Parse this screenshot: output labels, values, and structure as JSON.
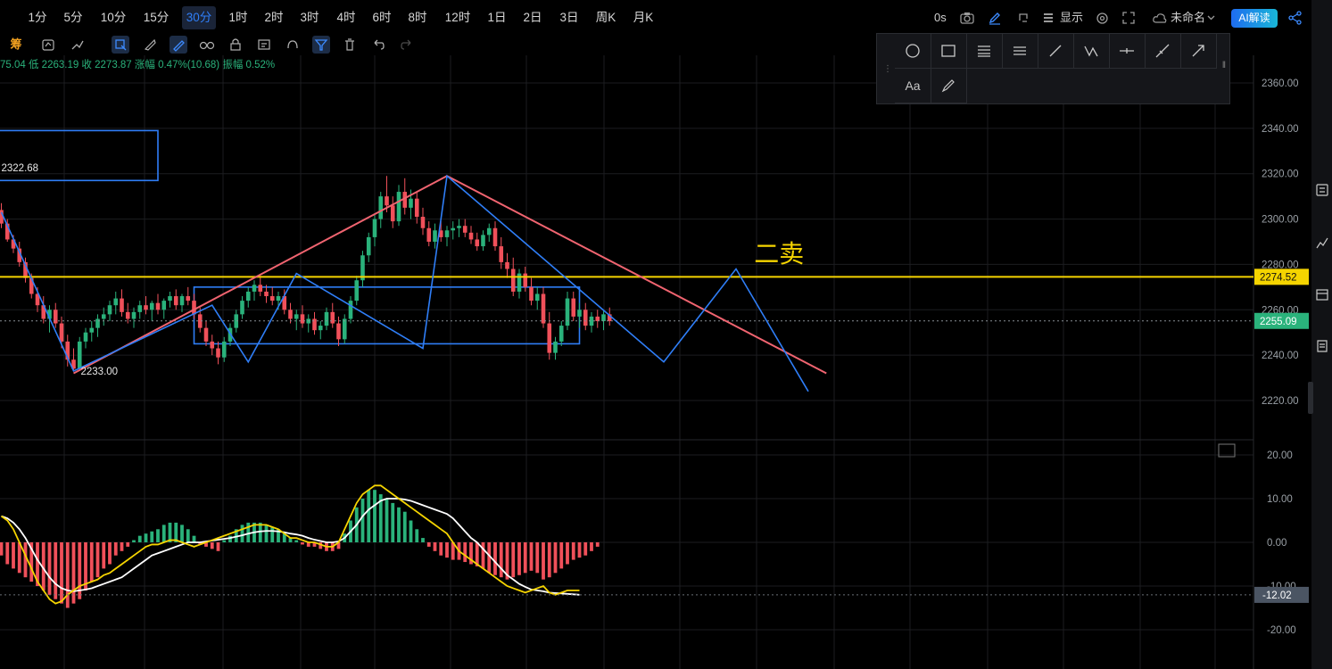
{
  "intervals": [
    "1分",
    "5分",
    "10分",
    "15分",
    "30分",
    "1时",
    "2时",
    "3时",
    "4时",
    "6时",
    "8时",
    "12时",
    "1日",
    "2日",
    "3日",
    "周K",
    "月K"
  ],
  "active_interval": "30分",
  "topbar_right": {
    "countdown": "0s",
    "display_label": "显示",
    "layout_name": "未命名",
    "ai_button": "AI解读"
  },
  "toolbar2": {
    "chip_label": "筹"
  },
  "ohlc_line": "75.04  低 2263.19  收 2273.87  涨幅 0.47%(10.68)  振幅 0.52%",
  "drawing_panel": {
    "text_tool": "Aa"
  },
  "colors": {
    "up": "#2ab27b",
    "down": "#f0505a",
    "trend": "#f06470",
    "blue": "#2f7ef7",
    "yellow": "#f5d400",
    "price_tag": "#2ab27b",
    "grid": "#1c1d20"
  },
  "chart_data": {
    "type": "candlestick",
    "main": {
      "ylim": [
        2210,
        2370
      ],
      "y_ticks": [
        "2360.00",
        "2340.00",
        "2320.00",
        "2300.00",
        "2280.00",
        "2260.00",
        "2240.00",
        "2220.00"
      ],
      "candles": [
        [
          2304,
          2307,
          2296,
          2298
        ],
        [
          2298,
          2300,
          2290,
          2291
        ],
        [
          2291,
          2293,
          2285,
          2287
        ],
        [
          2287,
          2290,
          2279,
          2281
        ],
        [
          2281,
          2283,
          2272,
          2274
        ],
        [
          2274,
          2276,
          2265,
          2267
        ],
        [
          2267,
          2270,
          2259,
          2262
        ],
        [
          2262,
          2266,
          2254,
          2256
        ],
        [
          2256,
          2262,
          2250,
          2260
        ],
        [
          2260,
          2263,
          2252,
          2254
        ],
        [
          2254,
          2257,
          2243,
          2246
        ],
        [
          2246,
          2249,
          2235,
          2238
        ],
        [
          2238,
          2243,
          2233,
          2234
        ],
        [
          2234,
          2248,
          2233,
          2246
        ],
        [
          2246,
          2252,
          2243,
          2250
        ],
        [
          2250,
          2255,
          2246,
          2252
        ],
        [
          2252,
          2258,
          2248,
          2256
        ],
        [
          2256,
          2261,
          2253,
          2258
        ],
        [
          2258,
          2264,
          2255,
          2262
        ],
        [
          2262,
          2268,
          2258,
          2265
        ],
        [
          2265,
          2269,
          2257,
          2259
        ],
        [
          2259,
          2263,
          2254,
          2256
        ],
        [
          2256,
          2261,
          2252,
          2259
        ],
        [
          2259,
          2264,
          2256,
          2262
        ],
        [
          2262,
          2266,
          2258,
          2260
        ],
        [
          2260,
          2264,
          2255,
          2263
        ],
        [
          2263,
          2267,
          2258,
          2260
        ],
        [
          2260,
          2265,
          2256,
          2264
        ],
        [
          2264,
          2268,
          2261,
          2266
        ],
        [
          2266,
          2269,
          2260,
          2262
        ],
        [
          2262,
          2267,
          2259,
          2266
        ],
        [
          2266,
          2270,
          2262,
          2264
        ],
        [
          2264,
          2267,
          2256,
          2258
        ],
        [
          2258,
          2261,
          2250,
          2252
        ],
        [
          2252,
          2255,
          2244,
          2246
        ],
        [
          2246,
          2249,
          2240,
          2243
        ],
        [
          2243,
          2246,
          2236,
          2239
        ],
        [
          2239,
          2248,
          2237,
          2246
        ],
        [
          2246,
          2254,
          2244,
          2252
        ],
        [
          2252,
          2260,
          2250,
          2258
        ],
        [
          2258,
          2266,
          2256,
          2264
        ],
        [
          2264,
          2270,
          2261,
          2268
        ],
        [
          2268,
          2273,
          2264,
          2271
        ],
        [
          2271,
          2275,
          2266,
          2268
        ],
        [
          2268,
          2271,
          2263,
          2266
        ],
        [
          2266,
          2270,
          2262,
          2264
        ],
        [
          2264,
          2268,
          2260,
          2266
        ],
        [
          2266,
          2269,
          2258,
          2260
        ],
        [
          2260,
          2263,
          2254,
          2256
        ],
        [
          2256,
          2260,
          2251,
          2258
        ],
        [
          2258,
          2262,
          2252,
          2254
        ],
        [
          2254,
          2258,
          2250,
          2256
        ],
        [
          2256,
          2259,
          2249,
          2251
        ],
        [
          2251,
          2255,
          2247,
          2253
        ],
        [
          2253,
          2261,
          2251,
          2259
        ],
        [
          2259,
          2263,
          2252,
          2254
        ],
        [
          2254,
          2257,
          2244,
          2247
        ],
        [
          2247,
          2258,
          2245,
          2256
        ],
        [
          2256,
          2266,
          2254,
          2264
        ],
        [
          2264,
          2275,
          2262,
          2273
        ],
        [
          2273,
          2286,
          2270,
          2284
        ],
        [
          2284,
          2294,
          2281,
          2292
        ],
        [
          2292,
          2302,
          2288,
          2300
        ],
        [
          2300,
          2312,
          2296,
          2310
        ],
        [
          2310,
          2319,
          2303,
          2306
        ],
        [
          2306,
          2310,
          2296,
          2299
        ],
        [
          2299,
          2315,
          2297,
          2312
        ],
        [
          2312,
          2318,
          2302,
          2305
        ],
        [
          2305,
          2313,
          2300,
          2309
        ],
        [
          2309,
          2312,
          2298,
          2301
        ],
        [
          2301,
          2305,
          2293,
          2296
        ],
        [
          2296,
          2299,
          2288,
          2290
        ],
        [
          2290,
          2298,
          2287,
          2295
        ],
        [
          2295,
          2299,
          2290,
          2292
        ],
        [
          2292,
          2297,
          2288,
          2295
        ],
        [
          2295,
          2299,
          2291,
          2296
        ],
        [
          2296,
          2300,
          2292,
          2297
        ],
        [
          2297,
          2300,
          2292,
          2294
        ],
        [
          2294,
          2297,
          2289,
          2291
        ],
        [
          2291,
          2294,
          2286,
          2288
        ],
        [
          2288,
          2295,
          2286,
          2293
        ],
        [
          2293,
          2298,
          2290,
          2296
        ],
        [
          2296,
          2299,
          2286,
          2288
        ],
        [
          2288,
          2292,
          2278,
          2281
        ],
        [
          2281,
          2285,
          2274,
          2278
        ],
        [
          2278,
          2283,
          2266,
          2268
        ],
        [
          2268,
          2278,
          2265,
          2276
        ],
        [
          2276,
          2279,
          2268,
          2270
        ],
        [
          2270,
          2274,
          2262,
          2264
        ],
        [
          2264,
          2270,
          2260,
          2267
        ],
        [
          2267,
          2270,
          2252,
          2254
        ],
        [
          2254,
          2259,
          2238,
          2241
        ],
        [
          2241,
          2248,
          2238,
          2246
        ],
        [
          2246,
          2255,
          2244,
          2253
        ],
        [
          2253,
          2268,
          2251,
          2265
        ],
        [
          2265,
          2268,
          2255,
          2257
        ],
        [
          2257,
          2263,
          2252,
          2260
        ],
        [
          2260,
          2263,
          2251,
          2253
        ],
        [
          2253,
          2259,
          2250,
          2257
        ],
        [
          2257,
          2260,
          2252,
          2255
        ],
        [
          2255,
          2260,
          2251,
          2258
        ],
        [
          2258,
          2261,
          2253,
          2255
        ]
      ],
      "labels": [
        {
          "text": "2322.68",
          "x": 0,
          "y": 2322.68
        },
        {
          "text": "2233.00",
          "x": 12,
          "y": 2233.0
        },
        {
          "text": "二卖",
          "x": 125,
          "y": 2281
        }
      ],
      "horizontal_level": {
        "value": "2274.52",
        "y": 2274.52
      },
      "last_price": {
        "value": "2255.09",
        "y": 2255.09
      },
      "trend_lines": [
        {
          "points": [
            [
              12,
              2232
            ],
            [
              74,
              2319
            ],
            [
              137,
              2232
            ]
          ],
          "color": "trend"
        },
        {
          "points": [
            [
              0,
              2303
            ],
            [
              12,
              2233
            ],
            [
              35,
              2262
            ],
            [
              41,
              2237
            ],
            [
              49,
              2276
            ],
            [
              70,
              2243
            ],
            [
              74,
              2319
            ],
            [
              110,
              2237
            ],
            [
              122,
              2278
            ],
            [
              134,
              2224
            ]
          ],
          "color": "blue"
        }
      ],
      "rectangles": [
        {
          "x0": -1,
          "x1": 26,
          "y0": 2339,
          "y1": 2317
        },
        {
          "x0": 32,
          "x1": 96,
          "y0": 2270,
          "y1": 2245
        }
      ]
    },
    "macd": {
      "ylim": [
        -25,
        25
      ],
      "y_ticks": [
        "20.00",
        "10.00",
        "0.00",
        "-10.00",
        "-20.00"
      ],
      "current": "-12.02",
      "hist": [
        -3,
        -5,
        -6,
        -7,
        -8,
        -9,
        -10,
        -11,
        -12,
        -13,
        -14,
        -15,
        -14,
        -13,
        -11,
        -9,
        -8,
        -6,
        -5,
        -3,
        -2,
        -1,
        0.5,
        1.5,
        2,
        2.5,
        3,
        4,
        4.5,
        4.5,
        4,
        3,
        1.5,
        -0.5,
        -1,
        -1.5,
        -2,
        0.5,
        1.5,
        3,
        4,
        4.5,
        4.5,
        4.5,
        4,
        3.5,
        3,
        2,
        1,
        0.5,
        -0.5,
        -1,
        -1,
        -1.5,
        -2,
        -2,
        -1.5,
        2,
        5,
        8,
        10,
        12,
        12,
        11,
        10,
        9,
        8,
        7,
        5,
        3,
        1,
        -1,
        -2,
        -3,
        -3.5,
        -4,
        -4,
        -4.5,
        -5,
        -5.5,
        -6,
        -7,
        -7.5,
        -8,
        -8.5,
        -8,
        -7.5,
        -7,
        -6.5,
        -7,
        -8.5,
        -8,
        -7,
        -6,
        -5,
        -4,
        -3.5,
        -3,
        -2,
        -1
      ],
      "dif": [
        6,
        5,
        3,
        0,
        -3,
        -6,
        -9,
        -11,
        -13,
        -14,
        -13.5,
        -12,
        -11,
        -10,
        -9.5,
        -9,
        -8.5,
        -7.5,
        -7,
        -6,
        -5,
        -4,
        -3,
        -2,
        -1,
        -0.5,
        -0.5,
        0,
        0.5,
        0.5,
        0,
        -0.5,
        -1,
        -0.5,
        0,
        0.5,
        1,
        1.5,
        2,
        2.5,
        3,
        3.5,
        4,
        4,
        4,
        3.5,
        3,
        2,
        1,
        1,
        0.5,
        0,
        0,
        -0.5,
        -1,
        -1,
        0,
        3,
        6,
        9,
        11,
        12,
        13,
        13,
        12,
        11,
        10,
        9,
        8,
        7,
        6,
        5,
        4,
        3,
        2,
        0,
        -2,
        -3,
        -4,
        -5,
        -6,
        -7,
        -8,
        -9,
        -10,
        -10.5,
        -11,
        -11.5,
        -11,
        -10.5,
        -10,
        -11.5,
        -12,
        -11.5,
        -11,
        -11,
        -11
      ],
      "dea": [
        6,
        5.5,
        4.5,
        3,
        1,
        -1.5,
        -4,
        -6,
        -8,
        -9.5,
        -10.5,
        -11,
        -11.2,
        -11,
        -10.8,
        -10.5,
        -10,
        -9.5,
        -9,
        -8.5,
        -8,
        -7,
        -6,
        -5,
        -4,
        -3,
        -2.5,
        -2,
        -1.5,
        -1,
        -0.5,
        0,
        0,
        0,
        0.2,
        0.4,
        0.6,
        0.8,
        1,
        1.3,
        1.6,
        2,
        2.3,
        2.5,
        2.6,
        2.6,
        2.5,
        2.3,
        2,
        1.8,
        1.5,
        1,
        0.6,
        0.3,
        0,
        0,
        0.2,
        1,
        2.5,
        4,
        6,
        7.5,
        8.5,
        9.5,
        10,
        10,
        10,
        9.8,
        9.5,
        9,
        8.5,
        8,
        7.5,
        7,
        6.5,
        5.5,
        4,
        2.5,
        1,
        0,
        -1.5,
        -3,
        -4.5,
        -6,
        -7.5,
        -8.5,
        -9.5,
        -10.2,
        -10.8,
        -11,
        -11.2,
        -11.5,
        -11.6,
        -11.7,
        -11.8,
        -11.9,
        -12
      ]
    }
  }
}
